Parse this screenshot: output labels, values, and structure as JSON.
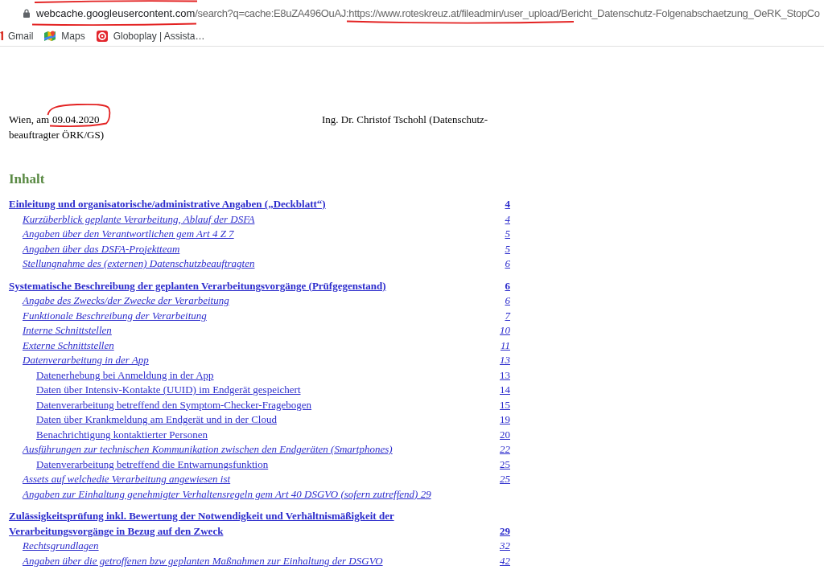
{
  "address_bar": {
    "host": "webcache.googleusercontent.com",
    "path": "/search?q=cache:E8uZA496OuAJ:https://www.roteskreuz.at/fileadmin/user_upload/Bericht_Datenschutz-Folgenabschaetzung_OeRK_StopCo"
  },
  "bookmarks": [
    {
      "label": "Gmail",
      "kind": "mail"
    },
    {
      "label": "Maps",
      "kind": "maps"
    },
    {
      "label": "Globoplay | Assista…",
      "kind": "play"
    }
  ],
  "document": {
    "place": "Wien, am",
    "date": "09.04.2020",
    "signer_lines": [
      "Ing. Dr. Christof Tschohl (Datenschutz-",
      "beauftragter ÖRK/GS)"
    ],
    "toc_heading": "Inhalt",
    "toc": [
      {
        "title": "Einleitung und organisatorische/administrative Angaben („Deckblatt“)",
        "page": "4",
        "children": [
          {
            "title": "Kurzüberblick geplante Verarbeitung, Ablauf der DSFA",
            "page": "4"
          },
          {
            "title": "Angaben über den Verantwortlichen gem Art 4 Z 7",
            "page": "5"
          },
          {
            "title": "Angaben über das DSFA-Projektteam",
            "page": "5"
          },
          {
            "title": "Stellungnahme des (externen) Datenschutzbeauftragten",
            "page": "6"
          }
        ]
      },
      {
        "title": "Systematische Beschreibung der geplanten Verarbeitungsvorgänge (Prüfgegenstand)",
        "page": "6",
        "children": [
          {
            "title": "Angabe des Zwecks/der Zwecke der Verarbeitung",
            "page": "6"
          },
          {
            "title": "Funktionale Beschreibung der Verarbeitung",
            "page": "7"
          },
          {
            "title": "Interne Schnittstellen",
            "page": "10"
          },
          {
            "title": "Externe Schnittstellen",
            "page": "11"
          },
          {
            "title": "Datenverarbeitung in der App",
            "page": "13",
            "children": [
              {
                "title": "Datenerhebung bei Anmeldung in der App",
                "page": "13"
              },
              {
                "title": "Daten über Intensiv-Kontakte (UUID) im Endgerät gespeichert",
                "page": "14"
              },
              {
                "title": "Datenverarbeitung betreffend den Symptom-Checker-Fragebogen",
                "page": "15"
              },
              {
                "title": "Daten über Krankmeldung am Endgerät und in der Cloud",
                "page": "19"
              },
              {
                "title": "Benachrichtigung kontaktierter Personen",
                "page": "20"
              }
            ]
          },
          {
            "title": "Ausführungen zur technischen Kommunikation zwischen den Endgeräten (Smartphones)",
            "page": "22",
            "children": [
              {
                "title": "Datenverarbeitung betreffend die Entwarnungsfunktion",
                "page": "25"
              }
            ]
          },
          {
            "title": "Assets auf welchedie Verarbeitung angewiesen ist",
            "page": "25"
          },
          {
            "title": "Angaben zur Einhaltung genehmigter Verhaltensregeln gem Art 40 DSGVO (sofern zutreffend) 29"
          }
        ]
      },
      {
        "title": "Zulässigkeitsprüfung inkl. Bewertung der Notwendigkeit und Verhältnismäßigkeit der Verarbeitungsvorgänge in Bezug auf den Zweck",
        "page": "29",
        "children": [
          {
            "title": "Rechtsgrundlagen",
            "page": "32"
          },
          {
            "title": "Angaben über die getroffenen bzw geplanten Maßnahmen zur Einhaltung der DSGVO",
            "page": "42"
          }
        ]
      }
    ]
  }
}
